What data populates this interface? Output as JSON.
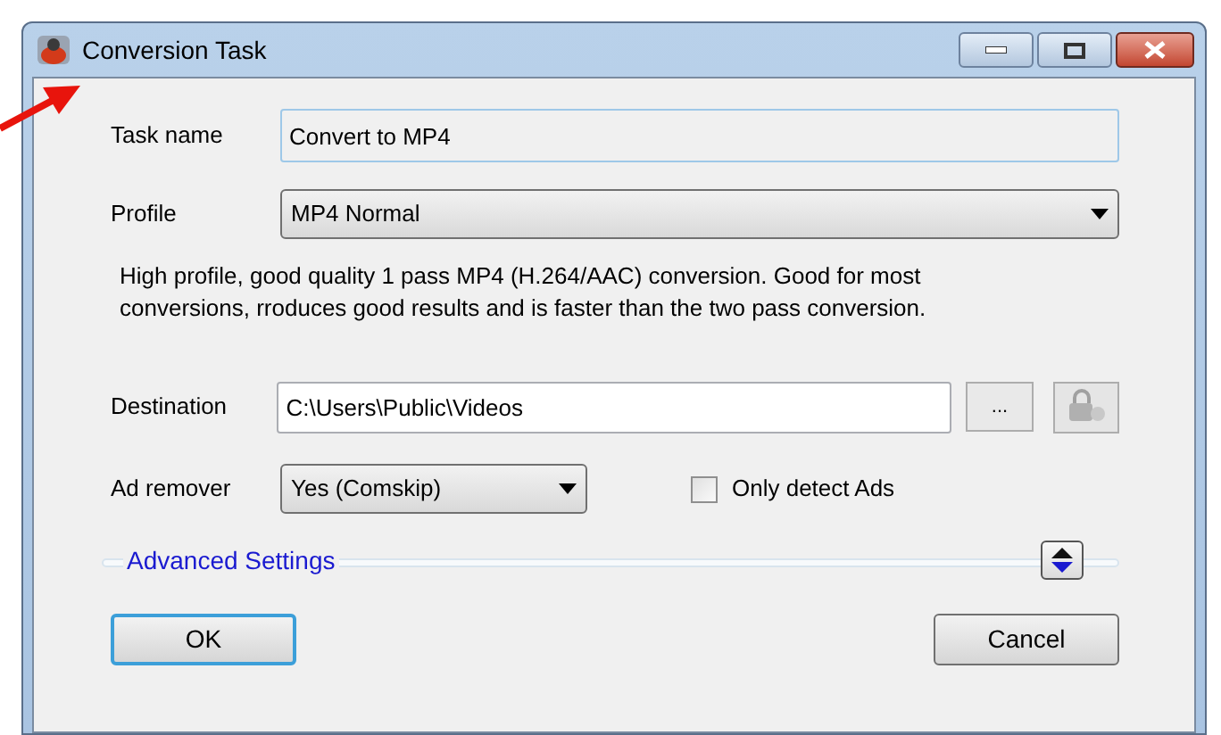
{
  "window": {
    "title": "Conversion Task"
  },
  "task_name": {
    "label": "Task name",
    "value": "Convert to MP4"
  },
  "profile": {
    "label": "Profile",
    "value": "MP4 Normal",
    "description": "High profile, good quality 1 pass MP4 (H.264/AAC) conversion. Good for most conversions, rroduces good results and is faster than the two pass conversion."
  },
  "destination": {
    "label": "Destination",
    "value": "C:\\Users\\Public\\Videos",
    "browse": "..."
  },
  "ad_remover": {
    "label": "Ad remover",
    "value": "Yes (Comskip)"
  },
  "only_detect_ads": {
    "label": "Only detect Ads",
    "checked": false
  },
  "advanced_settings": {
    "label": "Advanced Settings",
    "expanded": false
  },
  "buttons": [
    {
      "label": "OK",
      "default": true
    },
    {
      "label": "Cancel",
      "default": false
    }
  ]
}
